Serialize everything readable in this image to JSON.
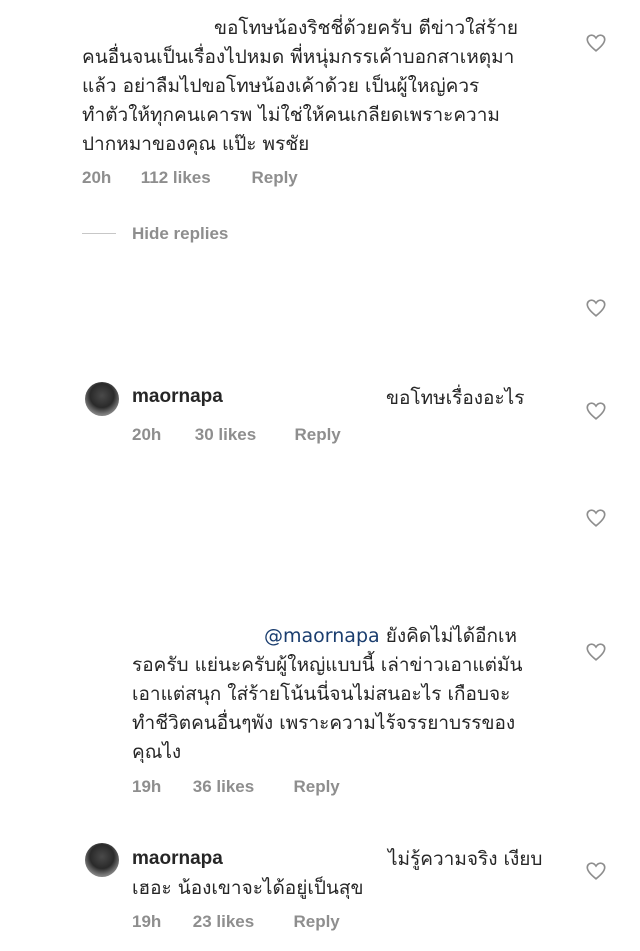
{
  "comments": [
    {
      "text": "ขอโทษน้องริชชี่ด้วยครับ ตีข่าวใส่ร้าย คนอื่นจนเป็นเรื่องไปหมด พี่หนุ่มกรรเค้าบอกสาเหตุมา แล้ว อย่าลืมไปขอโทษน้องเค้าด้วย เป็นผู้ใหญ่ควร ทำตัวให้ทุกคนเคารพ ไม่ใช่ให้คนเกลียดเพราะความ ปากหมาของคุณ แป๊ะ พรชัย",
      "lines": [
        "ขอโทษน้องริชชี่ด้วยครับ ตีข่าวใส่ร้าย",
        "คนอื่นจนเป็นเรื่องไปหมด พี่หนุ่มกรรเค้าบอกสาเหตุมา",
        "แล้ว อย่าลืมไปขอโทษน้องเค้าด้วย เป็นผู้ใหญ่ควร",
        "ทำตัวให้ทุกคนเคารพ ไม่ใช่ให้คนเกลียดเพราะความ",
        "ปากหมาของคุณ แป๊ะ พรชัย"
      ],
      "time": "20h",
      "likes": "112 likes",
      "reply": "Reply"
    }
  ],
  "hide_replies": "Hide replies",
  "replies": [
    {
      "username": "maornapa",
      "text": "ขอโทษเรื่องอะไร",
      "time": "20h",
      "likes": "30 likes",
      "reply": "Reply"
    },
    {
      "mention": "@maornapa",
      "lines": [
        "ยังคิดไม่ได้อีกเห",
        "รอครับ แย่นะครับผู้ใหญ่แบบนี้ เล่าข่าวเอาแต่มัน",
        "เอาแต่สนุก ใส่ร้ายโน้นนี่จนไม่สนอะไร เกือบจะ",
        "ทำชีวิตคนอื่นๆพัง เพราะความไร้จรรยาบรรของ",
        "คุณไง"
      ],
      "time": "19h",
      "likes": "36 likes",
      "reply": "Reply"
    },
    {
      "username": "maornapa",
      "lines": [
        "ไม่รู้ความจริง เงียบ",
        "เฮอะ น้องเขาจะได้อยู่เป็นสุข"
      ],
      "time": "19h",
      "likes": "23 likes",
      "reply": "Reply"
    }
  ],
  "icons": {
    "like": "heart-outline-icon",
    "avatar": "profile-avatar"
  },
  "colors": {
    "text": "#262626",
    "meta": "#8e8e8e",
    "mention": "#1a3d6e",
    "icon": "#8e8e8e"
  }
}
